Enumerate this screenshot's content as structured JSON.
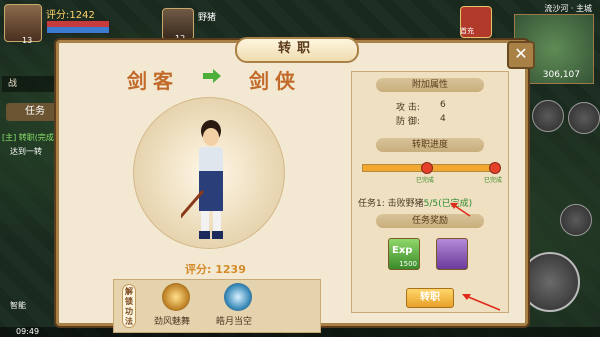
{
  "hud": {
    "player_score": "评分:1242",
    "player_level": "13",
    "target_level": "12",
    "target_name": "野猪",
    "map_name": "流沙河 · 主城",
    "coords": "306,107",
    "gift_label": "首充",
    "side_tab": "战",
    "task_tab": "任务",
    "quest_title": "[主] 转职(完成)",
    "quest_desc": "达到一转",
    "clock": "09:49",
    "smart_label": "智能"
  },
  "dialog": {
    "title": "转职",
    "close": "✕",
    "class_from": "剑客",
    "class_to": "剑侠",
    "score": "评分: 1239",
    "skill_tag": "解锁功法",
    "skills": [
      {
        "label": "劲风魅舞",
        "icon": "wind-dance-icon",
        "color": "#c2852a"
      },
      {
        "label": "皓月当空",
        "icon": "bright-moon-icon",
        "color": "#3a8ab8"
      }
    ],
    "attr_header": "附加属性",
    "attrs": [
      {
        "name": "攻  击:",
        "value": "6"
      },
      {
        "name": "防  御:",
        "value": "4"
      }
    ],
    "progress_header": "转职进度",
    "progress": 1.0,
    "done_label_1": "已完成",
    "done_label_2": "已完成",
    "task_text": "任务1: 击败野猪",
    "task_progress": "5/5(已完成)",
    "reward_header": "任务奖励",
    "reward_exp": "Exp",
    "reward_exp_count": "1500",
    "reward_item": "scroll-icon",
    "change_button": "转职"
  },
  "colors": {
    "accent": "#c26a2a",
    "success": "#2f8a2f",
    "annotation": "#e02a1a"
  }
}
